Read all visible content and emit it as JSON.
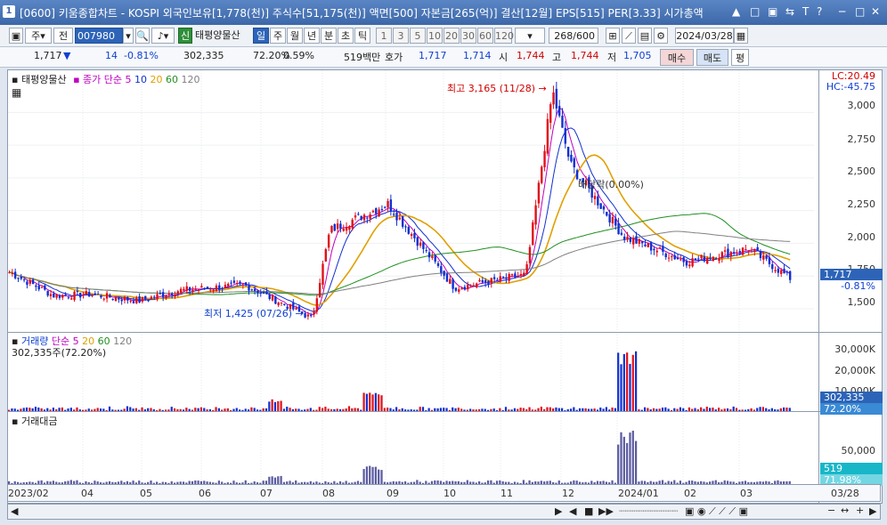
{
  "window": {
    "number": "1",
    "title": "[0600] 키움종합차트 - KOSPI 외국인보유[1,778(천)] 주식수[51,175(천)] 액면[500] 자본금[265(억)] 결산[12월] EPS[515] PER[3.33] 시가총액",
    "controls": [
      "▲",
      "□",
      "▣",
      "⇆",
      "T",
      "?",
      "─",
      "□",
      "✕"
    ]
  },
  "toolbar": {
    "market_label": "주",
    "prev_label": "전",
    "code_value": "007980",
    "stock_name": "태평양물산",
    "new_badge": "신",
    "period_tabs": [
      "일",
      "주",
      "월",
      "년",
      "분",
      "초",
      "틱"
    ],
    "active_period": "일",
    "intervals": [
      "1",
      "3",
      "5",
      "10",
      "20",
      "30",
      "60",
      "120"
    ],
    "count_value": "268",
    "count_total": "/600",
    "date_value": "2024/03/28"
  },
  "quote": {
    "price": "1,717",
    "direction": "▼",
    "change": "14",
    "change_pct": "-0.81%",
    "volume": "302,335",
    "volume_ratio": "72.20%",
    "turnover": "0.59%",
    "trade_value": "519백만",
    "bid_label": "호가",
    "ask": "1,717",
    "bid": "1,714",
    "open_label": "시",
    "open": "1,744",
    "high_label": "고",
    "high": "1,744",
    "low_label": "저",
    "low": "1,705",
    "buy_button": "매수",
    "sell_button": "매도",
    "eval_button": "평"
  },
  "price_pane": {
    "stock_label": "태평양물산",
    "ma_label": "종가 단순",
    "ma_periods": [
      "5",
      "10",
      "20",
      "60",
      "120"
    ],
    "ma_colors": [
      "#c000c0",
      "#1030d0",
      "#e0a000",
      "#209020",
      "#808080"
    ],
    "lc": "LC:20.49",
    "hc": "HC:-45.75",
    "yticks": [
      "3,000",
      "2,750",
      "2,500",
      "2,250",
      "2,000",
      "1,750",
      "1,500"
    ],
    "current_price": "1,717",
    "current_pct": "-0.81%",
    "high_annotation": "최고 3,165 (11/28)",
    "low_annotation": "최저 1,425 (07/26)",
    "dividend_annotation": "배당락(0.00%)"
  },
  "volume_pane": {
    "label": "거래량",
    "ma_label": "단순",
    "ma_periods": [
      "5",
      "20",
      "60",
      "120"
    ],
    "summary": "302,335주(72.20%)",
    "yticks": [
      "30,000K",
      "20,000K",
      "10,000K"
    ],
    "current_value": "302,335",
    "current_pct": "72.20%"
  },
  "amount_pane": {
    "label": "거래대금",
    "yticks": [
      "50,000"
    ],
    "current_value": "519",
    "current_pct": "71.98%"
  },
  "x_axis": {
    "labels": [
      "2023/02",
      "04",
      "05",
      "06",
      "07",
      "08",
      "09",
      "10",
      "11",
      "12",
      "2024/01",
      "02",
      "03",
      "03/28"
    ]
  },
  "chart_data": {
    "type": "candlestick",
    "ylim": [
      1350,
      3200
    ],
    "grid": true,
    "close_path": [
      {
        "date": "2023/02",
        "close": 1780
      },
      {
        "date": "2023/03",
        "close": 1600
      },
      {
        "date": "2023/04",
        "close": 1610
      },
      {
        "date": "2023/05",
        "close": 1560
      },
      {
        "date": "2023/06",
        "close": 1640
      },
      {
        "date": "2023/07",
        "close": 1680
      },
      {
        "date": "2023/07/26",
        "close": 1425
      },
      {
        "date": "2023/08",
        "close": 2100
      },
      {
        "date": "2023/09",
        "close": 2300
      },
      {
        "date": "2023/10",
        "close": 1660
      },
      {
        "date": "2023/11",
        "close": 1760
      },
      {
        "date": "2023/11/28",
        "close": 3165
      },
      {
        "date": "2023/12",
        "close": 2600
      },
      {
        "date": "2024/01",
        "close": 2050
      },
      {
        "date": "2024/02",
        "close": 1860
      },
      {
        "date": "2024/03",
        "close": 1960
      },
      {
        "date": "2024/03/28",
        "close": 1717
      }
    ]
  }
}
